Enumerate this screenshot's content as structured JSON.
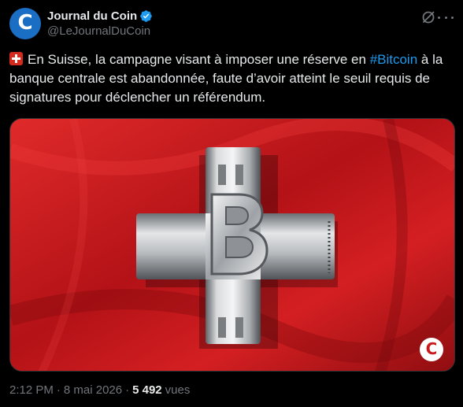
{
  "author": {
    "display_name": "Journal du Coin",
    "handle": "@LeJournalDuCoin",
    "avatar_letter": "C",
    "verified": true
  },
  "post": {
    "emoji": "swiss-flag",
    "text_before": "En Suisse, la campagne visant à imposer une réserve en ",
    "hashtag": "#Bitcoin",
    "text_after": " à la banque centrale est abandonnée, faute d’avoir atteint le seuil requis de signatures pour déclencher un référendum."
  },
  "media": {
    "description_icon": "swiss-bitcoin-cross",
    "watermark_letter": "C"
  },
  "meta": {
    "time": "2:12 PM",
    "separator": "·",
    "date": "8 mai 2026",
    "views_count": "5 492",
    "views_label": "vues"
  },
  "colors": {
    "background": "#000000",
    "text": "#e7e9ea",
    "secondary": "#71767b",
    "link": "#1d9bf0",
    "avatar": "#1a6fc4",
    "flag_red": "#c9191c"
  }
}
